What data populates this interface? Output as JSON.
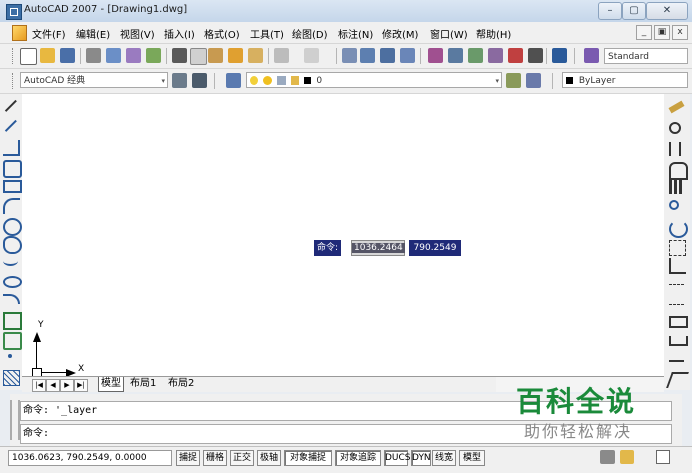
{
  "window": {
    "title": "AutoCAD 2007 - [Drawing1.dwg]",
    "minimize_glyph": "–",
    "maximize_glyph": "▢",
    "close_glyph": "✕"
  },
  "menu": {
    "items": [
      "文件(F)",
      "编辑(E)",
      "视图(V)",
      "插入(I)",
      "格式(O)",
      "工具(T)",
      "绘图(D)",
      "标注(N)",
      "修改(M)",
      "窗口(W)",
      "帮助(H)"
    ],
    "doc_minimize_glyph": "_",
    "doc_restore_glyph": "▣",
    "doc_close_glyph": "x"
  },
  "toolbar": {
    "text_style": "Standard",
    "workspace": "AutoCAD 经典",
    "layer_name": "0",
    "color_value": "ByLayer",
    "dropdown_arrow": "▾"
  },
  "drawing": {
    "ucs_x_label": "X",
    "ucs_y_label": "Y",
    "dynamic_input": {
      "prompt": "命令:",
      "x_value": "1036.2464",
      "y_value": "790.2549"
    }
  },
  "tabs": {
    "nav": [
      "|◀",
      "◀",
      "▶",
      "▶|"
    ],
    "items": [
      "模型",
      "布局1",
      "布局2"
    ]
  },
  "command": {
    "line1": "命令: '_layer",
    "line2": "命令:"
  },
  "status": {
    "coords": "1036.0623, 790.2549, 0.0000",
    "buttons": [
      "捕捉",
      "栅格",
      "正交",
      "极轴",
      "对象捕捉",
      "对象追踪",
      "DUCS",
      "DYN",
      "线宽",
      "模型"
    ]
  },
  "watermark": {
    "title": "百科全说",
    "subtitle": "助你轻松解决"
  },
  "colors": {
    "canvas": "#ffffff",
    "dynamic_input_bg": "#1f2a78",
    "watermark_green": "#1a8a3a"
  }
}
